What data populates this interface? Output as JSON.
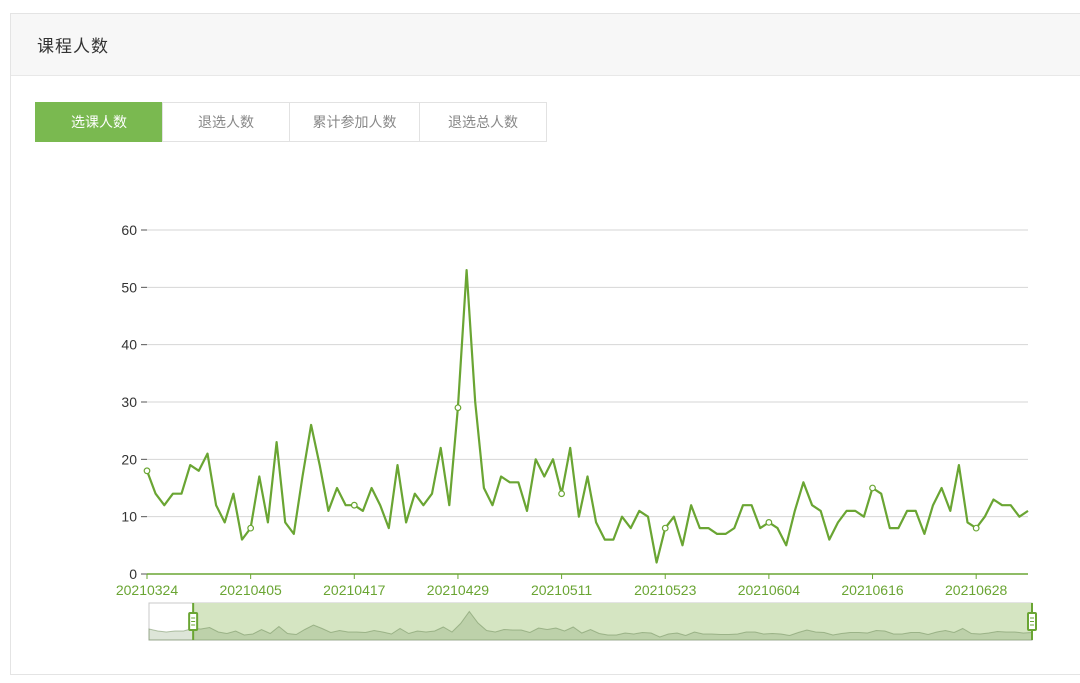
{
  "card": {
    "title": "课程人数"
  },
  "tabs": [
    {
      "label": "选课人数",
      "active": true
    },
    {
      "label": "退选人数",
      "active": false
    },
    {
      "label": "累计参加人数",
      "active": false
    },
    {
      "label": "退选总人数",
      "active": false
    }
  ],
  "colors": {
    "accent": "#6aa533",
    "tab_active": "#7ab950",
    "slider_fill": "#d5e5c2",
    "grid": "#cccccc"
  },
  "chart_data": {
    "type": "line",
    "y_ticks": [
      "0",
      "10",
      "20",
      "30",
      "40",
      "50",
      "60"
    ],
    "ylim": [
      0,
      60
    ],
    "x_tick_labels": [
      "20210324",
      "20210405",
      "20210417",
      "20210429",
      "20210511",
      "20210523",
      "20210604",
      "20210616",
      "20210628"
    ],
    "series": [
      {
        "values": [
          18,
          14,
          12,
          14,
          14,
          19,
          18,
          21,
          12,
          9,
          14,
          6,
          8,
          17,
          9,
          23,
          9,
          7,
          17,
          26,
          19,
          11,
          15,
          12,
          12,
          11,
          15,
          12,
          8,
          19,
          9,
          14,
          12,
          14,
          22,
          12,
          29,
          53,
          30,
          15,
          12,
          17,
          16,
          16,
          11,
          20,
          17,
          20,
          14,
          22,
          10,
          17,
          9,
          6,
          6,
          10,
          8,
          11,
          10,
          2,
          8,
          10,
          5,
          12,
          8,
          8,
          7,
          7,
          8,
          12,
          12,
          8,
          9,
          8,
          5,
          11,
          16,
          12,
          11,
          6,
          9,
          11,
          11,
          10,
          15,
          14,
          8,
          8,
          11,
          11,
          7,
          12,
          15,
          11,
          19,
          9,
          8,
          10,
          13,
          12,
          12,
          10,
          11
        ],
        "circle_indices": [
          0,
          12,
          24,
          36,
          48,
          60,
          72,
          84,
          96
        ]
      }
    ],
    "dataZoom": {
      "start_fraction": 0.05,
      "end_fraction": 1.0
    }
  }
}
